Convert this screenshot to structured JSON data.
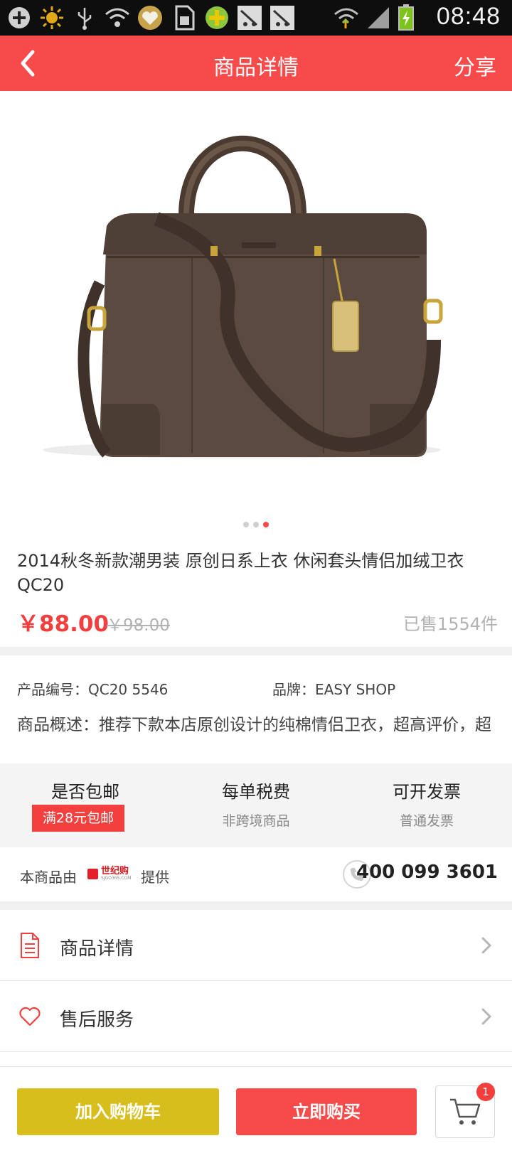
{
  "status_bar": {
    "time": "08:48",
    "icons": [
      "add-icon",
      "brightness-icon",
      "usb-icon",
      "wifi-question-icon",
      "heart-app-icon",
      "sim-card-icon",
      "plus-app-icon",
      "app-icon",
      "app-icon",
      "wifi-icon",
      "signal-icon",
      "battery-charging-icon"
    ]
  },
  "header": {
    "title": "商品详情",
    "back_icon": "chevron-left-icon",
    "share_label": "分享",
    "background": "#f74a4a"
  },
  "gallery": {
    "image_subject": "brown leather briefcase bag",
    "pages": 3,
    "active_page": 3
  },
  "product": {
    "title": "2014秋冬新款潮男装  原创日系上衣   休闲套头情侣加绒卫衣 QC20",
    "price": "￥88.00",
    "old_price": "￥98.00",
    "sold": "已售1554件"
  },
  "info": {
    "code": "产品编号：QC20 5546",
    "brand": "品牌：EASY SHOP",
    "description": "商品概述：推荐下款本店原创设计的纯棉情侣卫衣，超高评价，超"
  },
  "services": [
    {
      "title": "是否包邮",
      "badge": "满28元包邮"
    },
    {
      "title": "每单税费",
      "sub": "非跨境商品"
    },
    {
      "title": "可开发票",
      "sub": "普通发票"
    }
  ],
  "provider": {
    "prefix": "本商品由",
    "logo_text": "世纪购",
    "logo_sub": "SJGO365.COM",
    "suffix": "提供",
    "phone": "400 099 3601"
  },
  "menu": [
    {
      "label": "商品详情",
      "icon": "document-icon"
    },
    {
      "label": "售后服务",
      "icon": "heart-icon"
    }
  ],
  "bottom_bar": {
    "add_to_cart": "加入购物车",
    "buy_now": "立即购买",
    "cart_count": "1"
  },
  "colors": {
    "accent_red": "#f74a4a",
    "cart_yellow": "#d8be1c"
  }
}
